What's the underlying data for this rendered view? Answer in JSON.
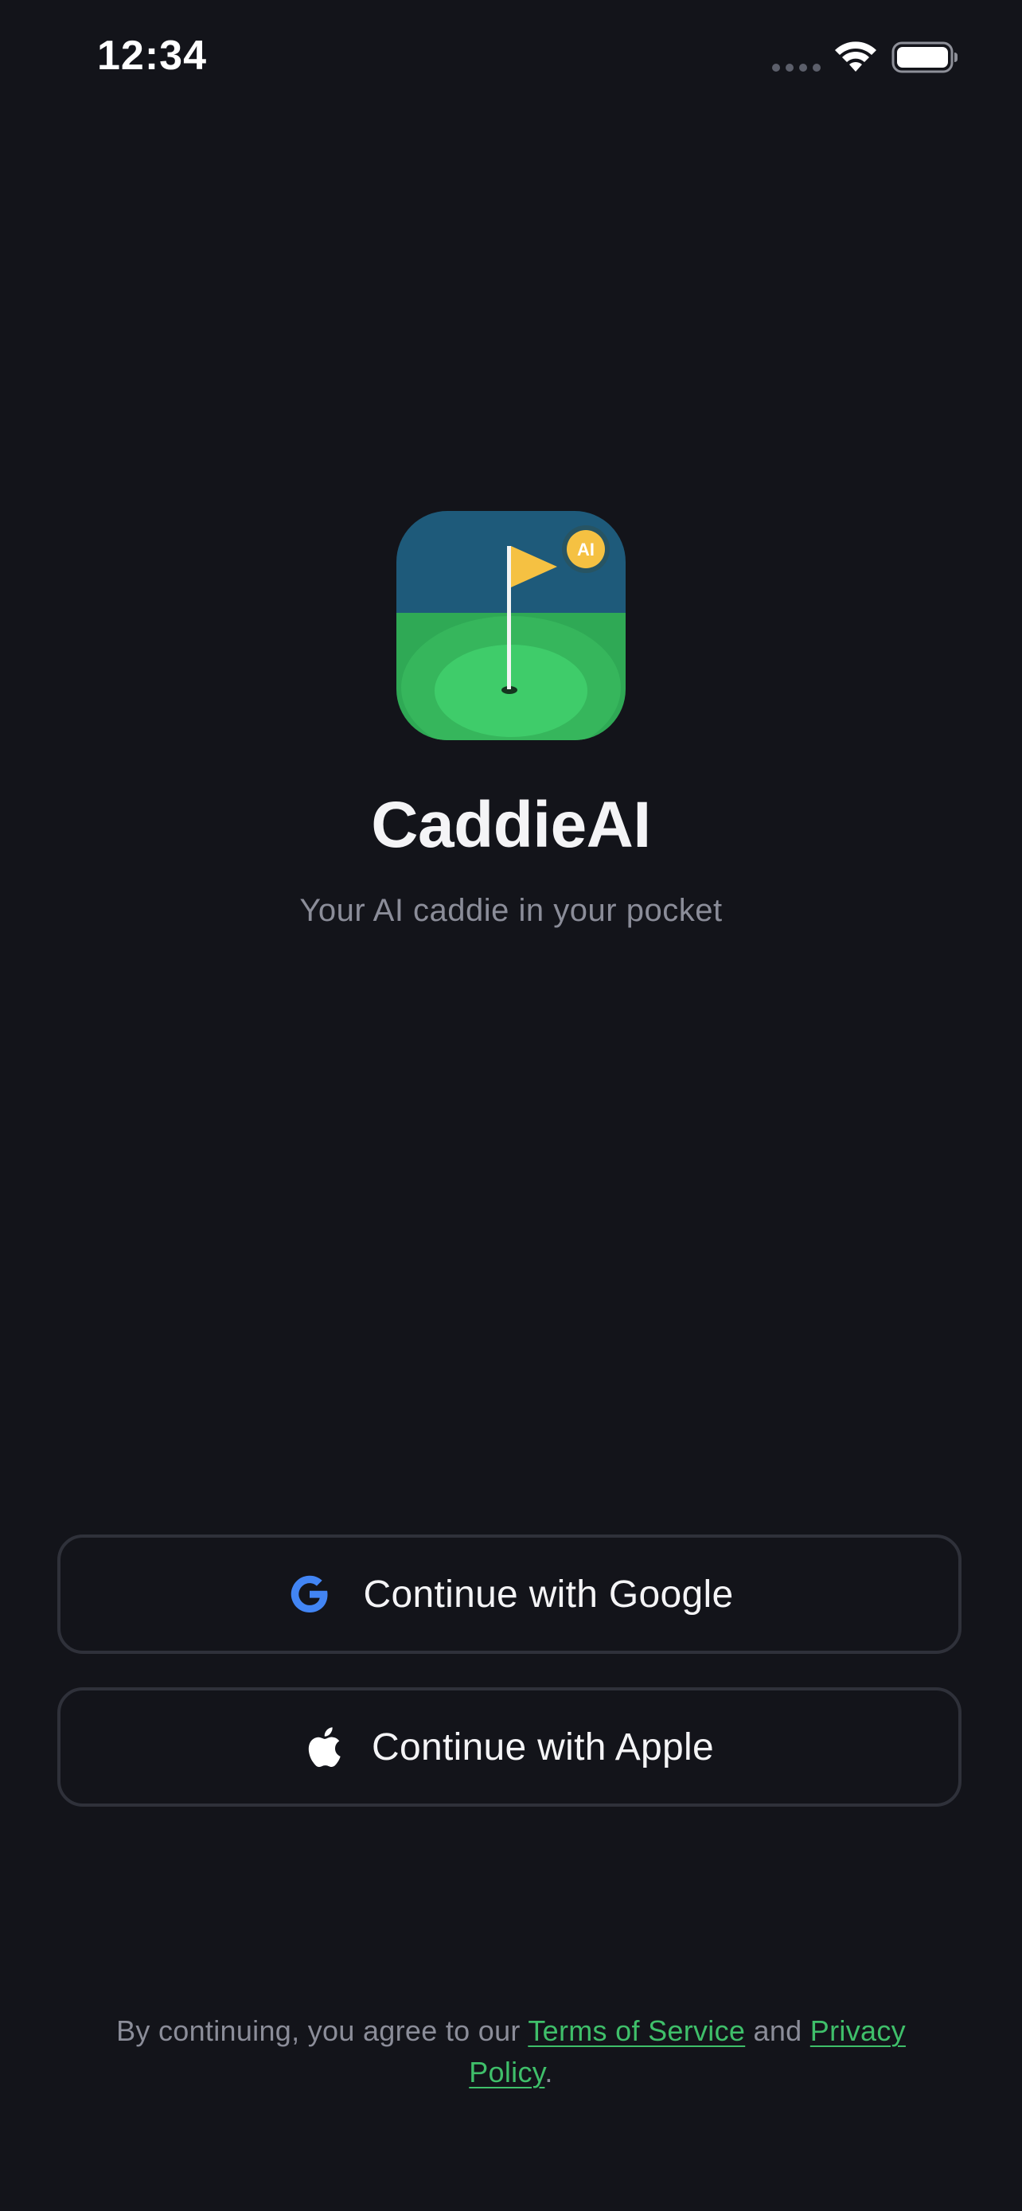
{
  "status_bar": {
    "time": "12:34",
    "signal_icon": "cellular-signal-icon",
    "wifi_icon": "wifi-icon",
    "battery_icon": "battery-icon"
  },
  "app": {
    "icon_name": "golf-flag-app-icon",
    "badge_text": "AI",
    "title": "CaddieAI",
    "tagline": "Your AI caddie in your pocket"
  },
  "auth": {
    "google_label": "Continue with Google",
    "google_icon": "google-icon",
    "apple_label": "Continue with Apple",
    "apple_icon": "apple-icon"
  },
  "legal": {
    "prefix": "By continuing, you agree to our ",
    "terms_label": "Terms of Service",
    "conjunction": " and ",
    "privacy_label": "Privacy Policy",
    "suffix": "."
  },
  "colors": {
    "background": "#13141a",
    "accent_green": "#3fbf6a",
    "flag_yellow": "#f5c142",
    "sky_blue": "#1e5a7a",
    "button_border": "#2f313a",
    "muted_text": "#8b8d99"
  }
}
